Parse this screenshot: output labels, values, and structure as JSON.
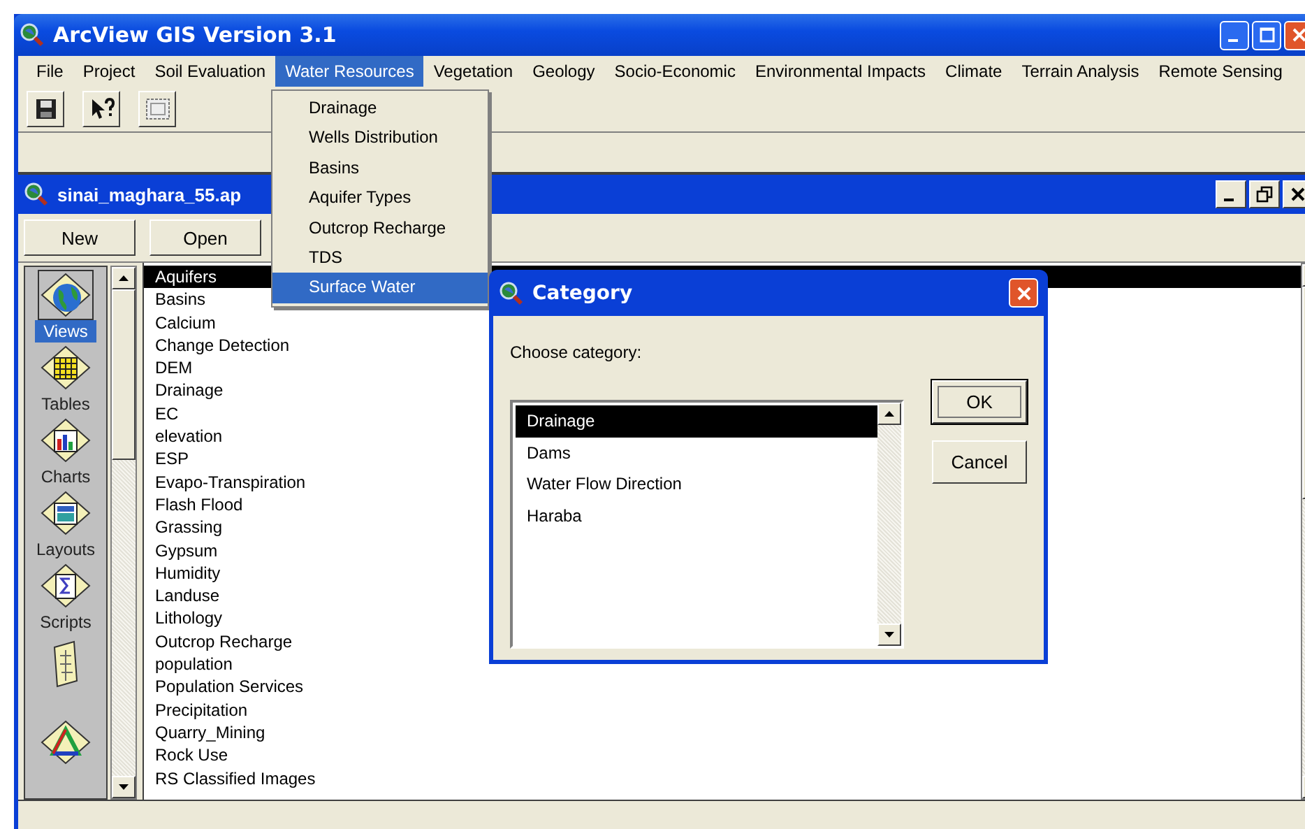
{
  "window": {
    "title": "ArcView GIS Version 3.1"
  },
  "menu_bar": [
    {
      "label": "File",
      "selected": false
    },
    {
      "label": "Project",
      "selected": false
    },
    {
      "label": "Soil Evaluation",
      "selected": false
    },
    {
      "label": "Water Resources",
      "selected": true
    },
    {
      "label": "Vegetation",
      "selected": false
    },
    {
      "label": "Geology",
      "selected": false
    },
    {
      "label": "Socio-Economic",
      "selected": false
    },
    {
      "label": "Environmental Impacts",
      "selected": false
    },
    {
      "label": "Climate",
      "selected": false
    },
    {
      "label": "Terrain Analysis",
      "selected": false
    },
    {
      "label": "Remote Sensing",
      "selected": false
    }
  ],
  "toolbar": [
    {
      "kind": "save"
    },
    {
      "kind": "help"
    },
    {
      "kind": "frame"
    }
  ],
  "open_menu": {
    "items": [
      {
        "label": "Drainage",
        "selected": false
      },
      {
        "label": "Wells Distribution",
        "selected": false
      },
      {
        "label": "Basins",
        "selected": false
      },
      {
        "label": "Aquifer Types",
        "selected": false
      },
      {
        "label": "Outcrop Recharge",
        "selected": false
      },
      {
        "label": "TDS",
        "selected": false
      },
      {
        "label": "Surface Water",
        "selected": true
      }
    ]
  },
  "project_window": {
    "title": "sinai_maghara_55.ap",
    "buttons": [
      "New",
      "Open"
    ],
    "doc_types": [
      {
        "kind": "views",
        "label": "Views",
        "selected": true
      },
      {
        "kind": "tables",
        "label": "Tables",
        "selected": false
      },
      {
        "kind": "charts",
        "label": "Charts",
        "selected": false
      },
      {
        "kind": "layouts",
        "label": "Layouts",
        "selected": false
      },
      {
        "kind": "scripts",
        "label": "Scripts",
        "selected": false
      },
      {
        "kind": "document",
        "selected": false
      },
      {
        "kind": "triangle",
        "selected": false
      }
    ],
    "documents": [
      {
        "label": "Aquifers",
        "selected": true
      },
      {
        "label": "Basins",
        "selected": false
      },
      {
        "label": "Calcium",
        "selected": false
      },
      {
        "label": "Change Detection",
        "selected": false
      },
      {
        "label": "DEM",
        "selected": false
      },
      {
        "label": "Drainage",
        "selected": false
      },
      {
        "label": "EC",
        "selected": false
      },
      {
        "label": "elevation",
        "selected": false
      },
      {
        "label": "ESP",
        "selected": false
      },
      {
        "label": "Evapo-Transpiration",
        "selected": false
      },
      {
        "label": "Flash Flood",
        "selected": false
      },
      {
        "label": "Grassing",
        "selected": false
      },
      {
        "label": "Gypsum",
        "selected": false
      },
      {
        "label": "Humidity",
        "selected": false
      },
      {
        "label": "Landuse",
        "selected": false
      },
      {
        "label": "Lithology",
        "selected": false
      },
      {
        "label": "Outcrop Recharge",
        "selected": false
      },
      {
        "label": "population",
        "selected": false
      },
      {
        "label": "Population Services",
        "selected": false
      },
      {
        "label": "Precipitation",
        "selected": false
      },
      {
        "label": "Quarry_Mining",
        "selected": false
      },
      {
        "label": "Rock Use",
        "selected": false
      },
      {
        "label": "RS Classified Images",
        "selected": false
      }
    ]
  },
  "dialog": {
    "title": "Category",
    "prompt": "Choose category:",
    "items": [
      {
        "label": "Drainage",
        "selected": true
      },
      {
        "label": "Dams",
        "selected": false
      },
      {
        "label": "Water Flow Direction",
        "selected": false
      },
      {
        "label": "Haraba",
        "selected": false
      }
    ],
    "buttons": [
      {
        "label": "OK",
        "default": true
      },
      {
        "label": "Cancel",
        "default": false
      }
    ]
  }
}
